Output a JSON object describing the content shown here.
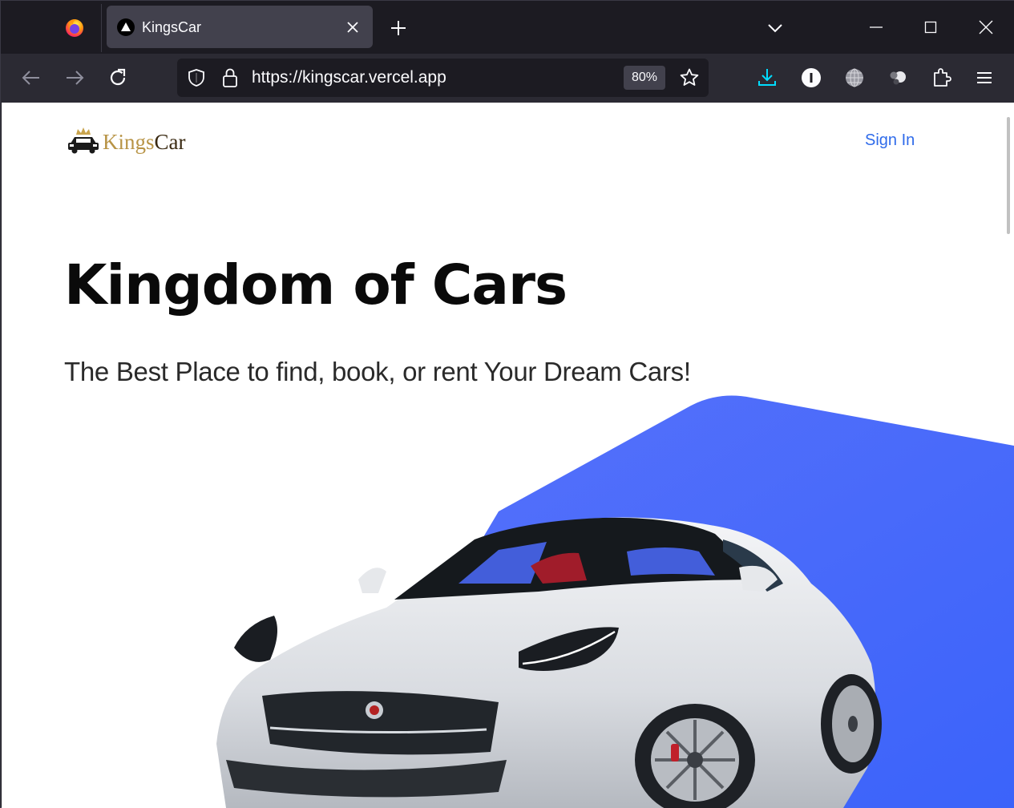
{
  "browser": {
    "tab": {
      "title": "KingsCar"
    },
    "url": "https://kingscar.vercel.app",
    "zoom": "80%",
    "icons": {
      "browser_logo": "firefox-logo-icon",
      "tab_favicon": "vercel-triangle-icon",
      "tab_close": "close-icon",
      "new_tab": "plus-icon",
      "tab_list": "chevron-down-icon",
      "minimize": "minimize-icon",
      "maximize": "maximize-icon",
      "close_window": "close-icon",
      "back": "arrow-left-icon",
      "forward": "arrow-right-icon",
      "reload": "reload-icon",
      "tracking_protection": "shield-icon",
      "secure": "lock-icon",
      "bookmark": "star-icon",
      "downloads": "download-icon",
      "extension_1": "info-circle-icon",
      "extension_2": "globe-icon",
      "extension_3": "spheres-icon",
      "extensions": "puzzle-icon",
      "menu": "hamburger-menu-icon"
    }
  },
  "page": {
    "logo": {
      "part1": "Kings",
      "part2": "Car",
      "icon": "crown-car-icon"
    },
    "nav": {
      "sign_in": "Sign In"
    },
    "hero": {
      "title": "Kingdom of Cars",
      "subtitle": "The Best Place to find, book, or rent Your Dream Cars!",
      "image": "white-sports-car-image"
    }
  },
  "colors": {
    "accent_blue": "#4b6bfb",
    "link_blue": "#2f6bea",
    "logo_gold": "#b89446",
    "logo_dark": "#3a2a12",
    "browser_dark": "#1c1b22",
    "toolbar": "#2b2a33",
    "download_accent": "#00ddff"
  }
}
